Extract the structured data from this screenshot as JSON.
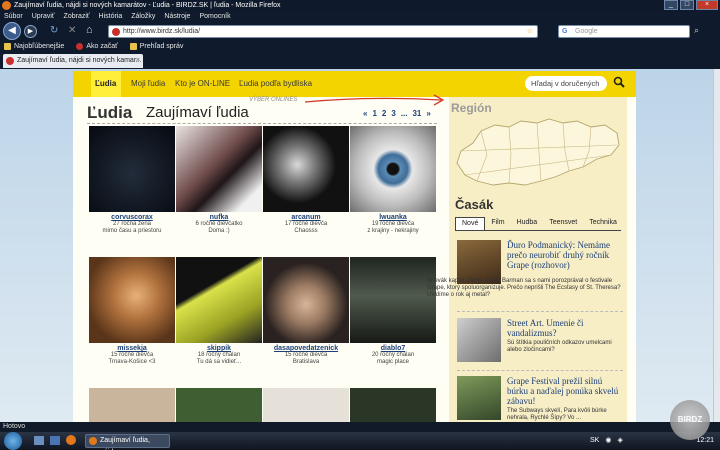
{
  "window": {
    "title": "Zaujímaví ľudia, nájdi si nových kamarátov - Ľudia - BIRDZ.SK | ľudia - Mozilla Firefox"
  },
  "menu": [
    "Súbor",
    "Upraviť",
    "Zobraziť",
    "História",
    "Záložky",
    "Nástroje",
    "Pomocník"
  ],
  "url": "http://www.birdz.sk/ludia/",
  "search_placeholder": "Google",
  "bookmarks": [
    "Najobľúbenejšie",
    "Ako začať",
    "Prehľad správ"
  ],
  "tab": {
    "title": "Zaujímaví ľudia, nájdi si nových kamar..."
  },
  "site": {
    "nav": [
      "Ľudia",
      "Moji ľudia",
      "Kto je ON-LINE",
      "Ľudia podľa bydliska"
    ],
    "search_placeholder": "Hľadaj v doručených",
    "heading": "Ľudia",
    "subheading": "Zaujímaví ľudia",
    "hint": "VÝBER ONLINES",
    "pager": [
      "«",
      "1",
      "2",
      "3",
      "...",
      "31",
      "»"
    ],
    "people": [
      {
        "nick": "corvuscorax",
        "line1": "27 ročná žena",
        "line2": "mimo času a priestoru"
      },
      {
        "nick": "nufka",
        "line1": "6 ročné dievčatko",
        "line2": "Doma :)"
      },
      {
        "nick": "arcanum",
        "line1": "17 ročné dievča",
        "line2": "Chaosss"
      },
      {
        "nick": "lwuanka",
        "line1": "19 ročné dievča",
        "line2": "z krajiny - nekrajiny"
      },
      {
        "nick": "missekja",
        "line1": "15 ročné dievča",
        "line2": "Trnava-Košice <3"
      },
      {
        "nick": "skippik",
        "line1": "18 ročný chalan",
        "line2": "Tu dá sa vidieť..."
      },
      {
        "nick": "dasapovedatzenick",
        "line1": "15 ročné dievča",
        "line2": "Bratislava"
      },
      {
        "nick": "diablo7",
        "line1": "20 ročný chalan",
        "line2": "magic place"
      }
    ],
    "region_title": "Región",
    "casak": {
      "title": "Časák",
      "tabs": [
        "Nové",
        "Film",
        "Hudba",
        "Teensvet",
        "Technika"
      ],
      "articles": [
        {
          "title": "Ďuro Podmanický: Nemáme prečo neurobiť druhý ročník Grape (rozhovor)",
          "desc": "Spevák kapiel Cliché a Billy Barman sa s nami porozprával o festivale Grape, ktorý spoluorganizuje. Prečo neprišli The Ecstasy of St. Theresa? Uvidíme o rok aj metal?"
        },
        {
          "title": "Street Art. Umenie či vandalizmus?",
          "desc": "Sú štítkia pouličních odkazov umelcami alebo zločincami?"
        },
        {
          "title": "Grape Festival prežil silnú búrku a naďalej ponúka skvelú zábavu!",
          "desc": "The Subways skvelí, Para kvôli búrke nehrala, Rychlé Šípy? Vo ..."
        }
      ]
    }
  },
  "status": "Hotovo",
  "taskbar": {
    "button": "Zaujímaví ľudia, nájd...",
    "lang": "SK",
    "time": "12:21"
  },
  "watermark": "BIRDZ"
}
